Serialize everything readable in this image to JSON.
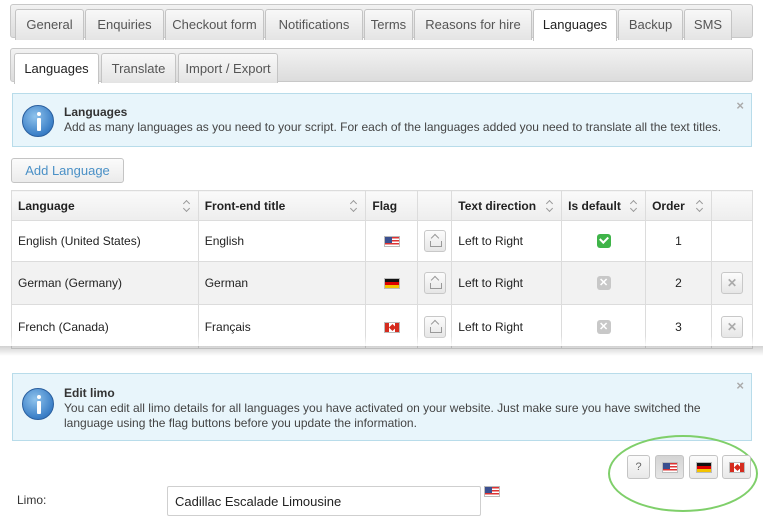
{
  "top_tabs": [
    {
      "label": "General"
    },
    {
      "label": "Enquiries"
    },
    {
      "label": "Checkout form"
    },
    {
      "label": "Notifications"
    },
    {
      "label": "Terms"
    },
    {
      "label": "Reasons for hire"
    },
    {
      "label": "Languages",
      "active": true
    },
    {
      "label": "Backup"
    },
    {
      "label": "SMS"
    }
  ],
  "sub_tabs": [
    {
      "label": "Languages",
      "active": true
    },
    {
      "label": "Translate"
    },
    {
      "label": "Import / Export"
    }
  ],
  "languages_info": {
    "title": "Languages",
    "text": "Add as many languages as you need to your script. For each of the languages added you need to translate all the text titles.",
    "close": "×"
  },
  "add_language_label": "Add Language",
  "table": {
    "headers": [
      "Language",
      "Front-end title",
      "Flag",
      "",
      "Text direction",
      "Is default",
      "Order",
      ""
    ],
    "rows": [
      {
        "language": "English (United States)",
        "title": "English",
        "flag": "flag-us",
        "direction": "Left to Right",
        "is_default": true,
        "order": "1",
        "deletable": false
      },
      {
        "language": "German (Germany)",
        "title": "German",
        "flag": "flag-de",
        "direction": "Left to Right",
        "is_default": false,
        "order": "2",
        "deletable": true
      },
      {
        "language": "French (Canada)",
        "title": "Français",
        "flag": "flag-ca",
        "direction": "Left to Right",
        "is_default": false,
        "order": "3",
        "deletable": true
      }
    ]
  },
  "edit_info": {
    "title": "Edit limo",
    "text": "You can edit all limo details for all languages you have activated on your website. Just make sure you have switched the language using the flag buttons before you update the information.",
    "close": "×"
  },
  "language_switcher": {
    "help_label": "?",
    "flags": [
      "flag-us",
      "flag-de",
      "flag-ca"
    ],
    "active_flag": "flag-us"
  },
  "limo_field": {
    "label": "Limo:",
    "value": "Cadillac Escalade Limousine",
    "flag": "flag-us"
  },
  "colors": {
    "info_bg": "#e8f5fb",
    "info_border": "#b8dcea",
    "link_blue": "#4a90c6",
    "default_green": "#3fb449",
    "highlight_ring": "#7fcf6a"
  }
}
